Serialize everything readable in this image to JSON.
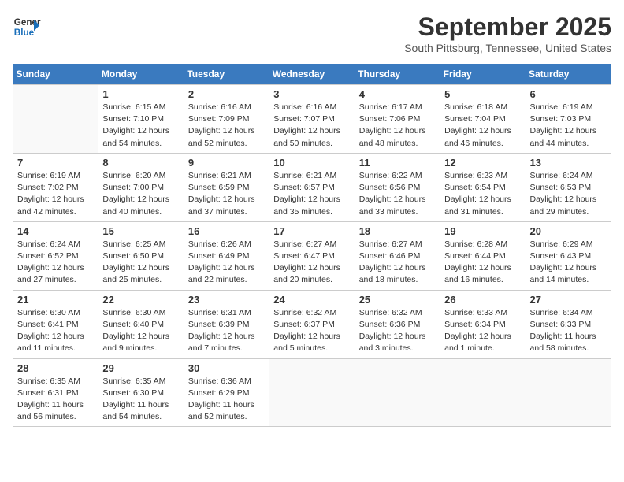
{
  "header": {
    "logo_line1": "General",
    "logo_line2": "Blue",
    "month": "September 2025",
    "location": "South Pittsburg, Tennessee, United States"
  },
  "days_of_week": [
    "Sunday",
    "Monday",
    "Tuesday",
    "Wednesday",
    "Thursday",
    "Friday",
    "Saturday"
  ],
  "weeks": [
    [
      {
        "num": "",
        "info": ""
      },
      {
        "num": "1",
        "info": "Sunrise: 6:15 AM\nSunset: 7:10 PM\nDaylight: 12 hours\nand 54 minutes."
      },
      {
        "num": "2",
        "info": "Sunrise: 6:16 AM\nSunset: 7:09 PM\nDaylight: 12 hours\nand 52 minutes."
      },
      {
        "num": "3",
        "info": "Sunrise: 6:16 AM\nSunset: 7:07 PM\nDaylight: 12 hours\nand 50 minutes."
      },
      {
        "num": "4",
        "info": "Sunrise: 6:17 AM\nSunset: 7:06 PM\nDaylight: 12 hours\nand 48 minutes."
      },
      {
        "num": "5",
        "info": "Sunrise: 6:18 AM\nSunset: 7:04 PM\nDaylight: 12 hours\nand 46 minutes."
      },
      {
        "num": "6",
        "info": "Sunrise: 6:19 AM\nSunset: 7:03 PM\nDaylight: 12 hours\nand 44 minutes."
      }
    ],
    [
      {
        "num": "7",
        "info": "Sunrise: 6:19 AM\nSunset: 7:02 PM\nDaylight: 12 hours\nand 42 minutes."
      },
      {
        "num": "8",
        "info": "Sunrise: 6:20 AM\nSunset: 7:00 PM\nDaylight: 12 hours\nand 40 minutes."
      },
      {
        "num": "9",
        "info": "Sunrise: 6:21 AM\nSunset: 6:59 PM\nDaylight: 12 hours\nand 37 minutes."
      },
      {
        "num": "10",
        "info": "Sunrise: 6:21 AM\nSunset: 6:57 PM\nDaylight: 12 hours\nand 35 minutes."
      },
      {
        "num": "11",
        "info": "Sunrise: 6:22 AM\nSunset: 6:56 PM\nDaylight: 12 hours\nand 33 minutes."
      },
      {
        "num": "12",
        "info": "Sunrise: 6:23 AM\nSunset: 6:54 PM\nDaylight: 12 hours\nand 31 minutes."
      },
      {
        "num": "13",
        "info": "Sunrise: 6:24 AM\nSunset: 6:53 PM\nDaylight: 12 hours\nand 29 minutes."
      }
    ],
    [
      {
        "num": "14",
        "info": "Sunrise: 6:24 AM\nSunset: 6:52 PM\nDaylight: 12 hours\nand 27 minutes."
      },
      {
        "num": "15",
        "info": "Sunrise: 6:25 AM\nSunset: 6:50 PM\nDaylight: 12 hours\nand 25 minutes."
      },
      {
        "num": "16",
        "info": "Sunrise: 6:26 AM\nSunset: 6:49 PM\nDaylight: 12 hours\nand 22 minutes."
      },
      {
        "num": "17",
        "info": "Sunrise: 6:27 AM\nSunset: 6:47 PM\nDaylight: 12 hours\nand 20 minutes."
      },
      {
        "num": "18",
        "info": "Sunrise: 6:27 AM\nSunset: 6:46 PM\nDaylight: 12 hours\nand 18 minutes."
      },
      {
        "num": "19",
        "info": "Sunrise: 6:28 AM\nSunset: 6:44 PM\nDaylight: 12 hours\nand 16 minutes."
      },
      {
        "num": "20",
        "info": "Sunrise: 6:29 AM\nSunset: 6:43 PM\nDaylight: 12 hours\nand 14 minutes."
      }
    ],
    [
      {
        "num": "21",
        "info": "Sunrise: 6:30 AM\nSunset: 6:41 PM\nDaylight: 12 hours\nand 11 minutes."
      },
      {
        "num": "22",
        "info": "Sunrise: 6:30 AM\nSunset: 6:40 PM\nDaylight: 12 hours\nand 9 minutes."
      },
      {
        "num": "23",
        "info": "Sunrise: 6:31 AM\nSunset: 6:39 PM\nDaylight: 12 hours\nand 7 minutes."
      },
      {
        "num": "24",
        "info": "Sunrise: 6:32 AM\nSunset: 6:37 PM\nDaylight: 12 hours\nand 5 minutes."
      },
      {
        "num": "25",
        "info": "Sunrise: 6:32 AM\nSunset: 6:36 PM\nDaylight: 12 hours\nand 3 minutes."
      },
      {
        "num": "26",
        "info": "Sunrise: 6:33 AM\nSunset: 6:34 PM\nDaylight: 12 hours\nand 1 minute."
      },
      {
        "num": "27",
        "info": "Sunrise: 6:34 AM\nSunset: 6:33 PM\nDaylight: 11 hours\nand 58 minutes."
      }
    ],
    [
      {
        "num": "28",
        "info": "Sunrise: 6:35 AM\nSunset: 6:31 PM\nDaylight: 11 hours\nand 56 minutes."
      },
      {
        "num": "29",
        "info": "Sunrise: 6:35 AM\nSunset: 6:30 PM\nDaylight: 11 hours\nand 54 minutes."
      },
      {
        "num": "30",
        "info": "Sunrise: 6:36 AM\nSunset: 6:29 PM\nDaylight: 11 hours\nand 52 minutes."
      },
      {
        "num": "",
        "info": ""
      },
      {
        "num": "",
        "info": ""
      },
      {
        "num": "",
        "info": ""
      },
      {
        "num": "",
        "info": ""
      }
    ]
  ]
}
